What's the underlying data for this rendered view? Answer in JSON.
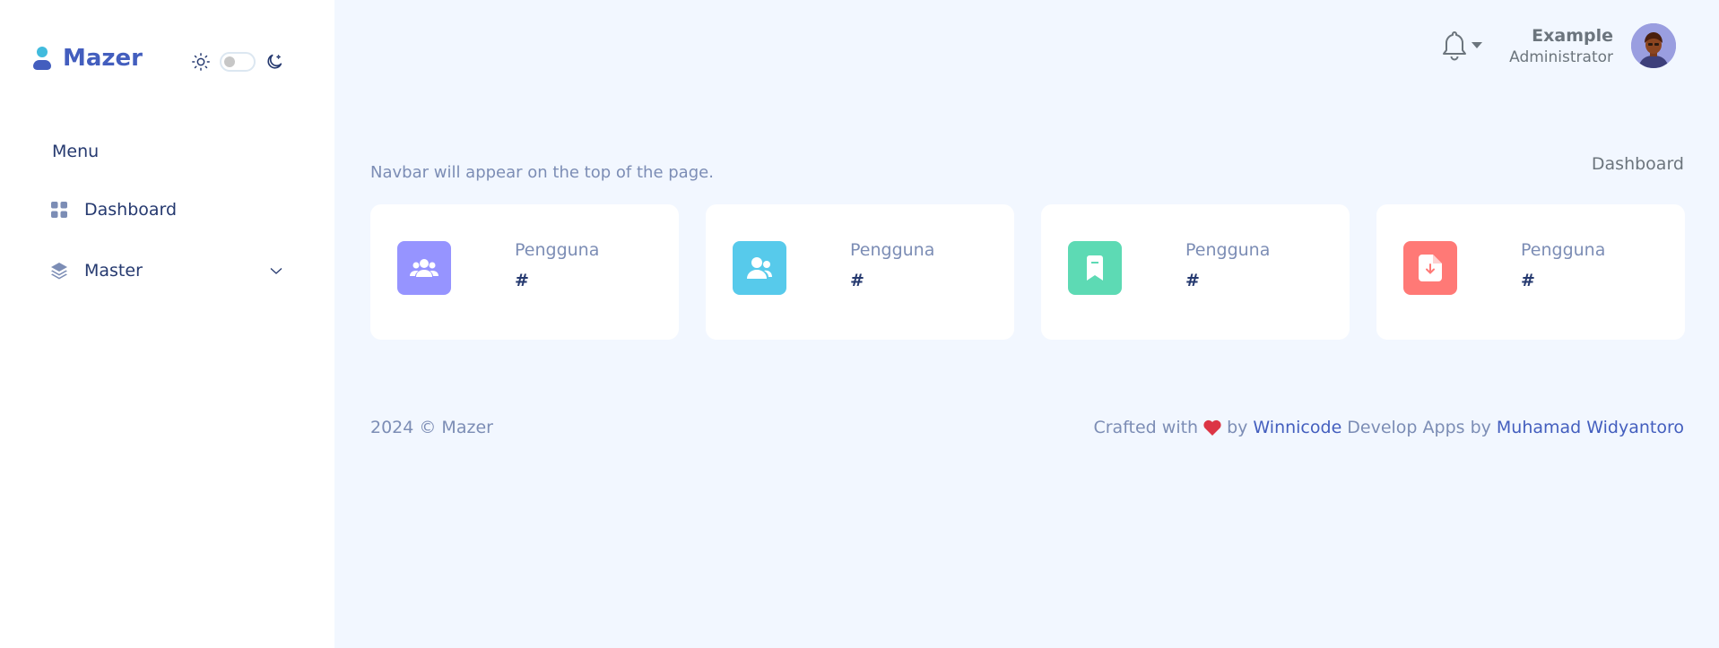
{
  "sidebar": {
    "logo_text": "Mazer",
    "menu_title": "Menu",
    "items": [
      {
        "label": "Dashboard",
        "icon": "grid-icon"
      },
      {
        "label": "Master",
        "icon": "layers-icon",
        "has_submenu": true
      }
    ]
  },
  "theme": {
    "light_icon": "sun-icon",
    "dark_icon": "moon-icon",
    "dark_mode": false
  },
  "header": {
    "user_name": "Example",
    "user_role": "Administrator"
  },
  "page": {
    "subtitle": "Navbar will appear on the top of the page.",
    "breadcrumb": "Dashboard"
  },
  "stats": [
    {
      "label": "Pengguna",
      "value": "#",
      "color": "#9694ff",
      "icon": "users-icon"
    },
    {
      "label": "Pengguna",
      "value": "#",
      "color": "#57caeb",
      "icon": "user-icon"
    },
    {
      "label": "Pengguna",
      "value": "#",
      "color": "#5ddab4",
      "icon": "bookmark-icon"
    },
    {
      "label": "Pengguna",
      "value": "#",
      "color": "#ff7976",
      "icon": "file-download-icon"
    }
  ],
  "footer": {
    "copyright": "2024 © Mazer",
    "crafted_with": "Crafted with",
    "by": "by",
    "company": "Winnicode",
    "develop_text": "Develop Apps by",
    "author": "Muhamad Widyantoro",
    "heart_color": "#dc3545"
  }
}
